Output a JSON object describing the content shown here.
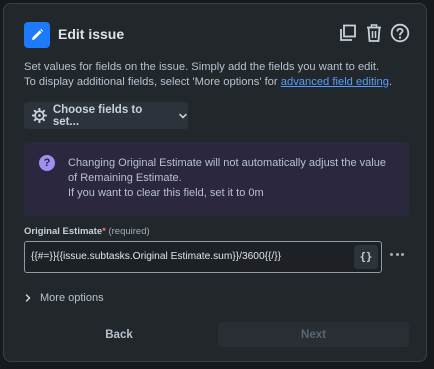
{
  "header": {
    "title": "Edit issue",
    "icons": [
      "pencil-icon",
      "copy-icon",
      "trash-icon",
      "help-icon"
    ]
  },
  "description": {
    "line1": "Set values for fields on the issue. Simply add the fields you want to edit.",
    "line2_prefix": "To display additional fields, select 'More options' for ",
    "line2_link": "advanced field editing",
    "line2_suffix": "."
  },
  "choose_fields": {
    "label": "Choose fields to set...",
    "icon": "gear-icon"
  },
  "info": {
    "icon": "question-icon",
    "line1": "Changing Original Estimate will not automatically adjust the value",
    "line2": "of Remaining Estimate.",
    "line3": "If you want to clear this field, set it to 0m"
  },
  "field": {
    "label": "Original Estimate",
    "required_mark": "*",
    "required_text": "(required)",
    "value": "{{#=}}{{issue.subtasks.Original Estimate.sum}}/3600{{/}}",
    "smart_value_button": "{}"
  },
  "more_options": {
    "label": "More options"
  },
  "footer": {
    "back_label": "Back",
    "next_label": "Next"
  },
  "colors": {
    "accent": "#1d7afc",
    "link": "#579dff",
    "info_bg": "#2b273f",
    "info_icon": "#9f8fef",
    "required": "#f87168"
  }
}
